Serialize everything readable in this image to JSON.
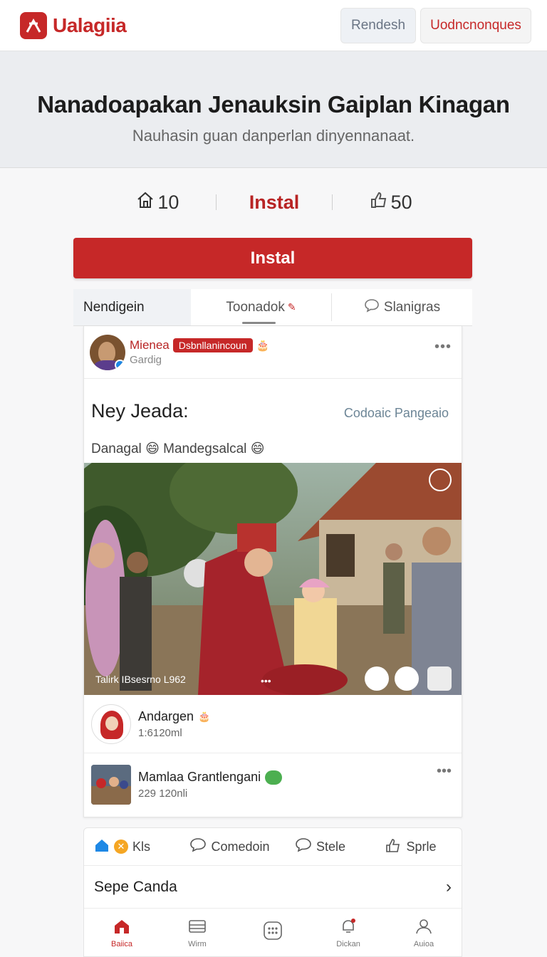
{
  "app": {
    "name": "Ualagiia",
    "brand_color": "#c62828"
  },
  "topbar": {
    "refresh_label": "Rendesh",
    "other_label": "Uodncnonques"
  },
  "hero": {
    "title": "Nanadoapakan Jenauksin Gaiplan Kinagan",
    "subtitle": "Nauhasin guan danperlan dinyennanaat."
  },
  "stats": {
    "left_value": "10",
    "center_label": "Instal",
    "right_value": "50"
  },
  "install_button": "Instal",
  "tabs": [
    {
      "label": "Nendigein"
    },
    {
      "label": "Toonadok"
    },
    {
      "label": "Slanigras"
    }
  ],
  "post": {
    "author": "Mienea",
    "badge": "Dsbnllanincoun",
    "meta": "Gardig",
    "title": "Ney Jeada:",
    "title_link": "Codoaic Pangeaio",
    "subline_a": "Danagal",
    "subline_b": "Mandegsalcal",
    "media_caption": "Talirk IBsesrno L962",
    "media_dots": "•••"
  },
  "comments": [
    {
      "name": "Andargen",
      "sub": "1:6120ml"
    },
    {
      "name": "Mamlaa Grantlengani",
      "sub": "229 120nli"
    }
  ],
  "actions": [
    {
      "label": "Kls",
      "icon": "home-icon"
    },
    {
      "label": "Comedoin",
      "icon": "comment-icon"
    },
    {
      "label": "Stele",
      "icon": "chat-icon"
    },
    {
      "label": "Sprle",
      "icon": "share-icon"
    }
  ],
  "see_more": "Sepe Canda",
  "nav": [
    {
      "label": "Baiica",
      "icon": "home-icon"
    },
    {
      "label": "Wirm",
      "icon": "inbox-icon"
    },
    {
      "label": "",
      "icon": "apps-icon"
    },
    {
      "label": "Dickan",
      "icon": "bell-icon"
    },
    {
      "label": "Auioa",
      "icon": "profile-icon"
    }
  ]
}
